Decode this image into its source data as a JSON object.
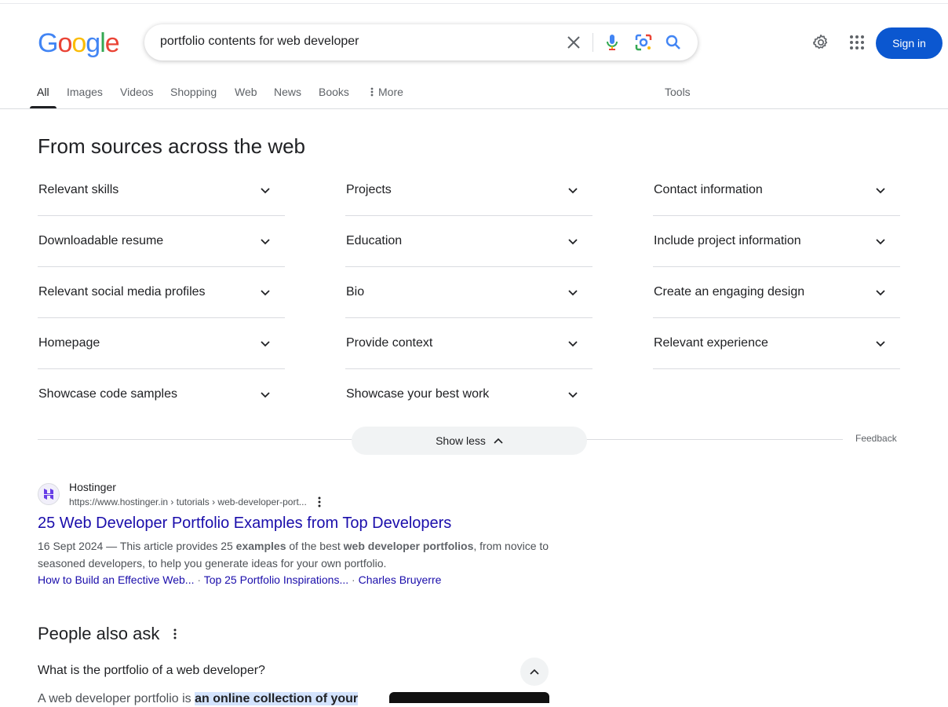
{
  "search": {
    "query": "portfolio contents for web developer"
  },
  "header": {
    "signin_label": "Sign in",
    "logo": [
      "G",
      "o",
      "o",
      "g",
      "l",
      "e"
    ],
    "logo_colors": [
      "#4285F4",
      "#EA4335",
      "#FBBC05",
      "#4285F4",
      "#34A853",
      "#EA4335"
    ]
  },
  "tabs": [
    {
      "label": "All",
      "active": true
    },
    {
      "label": "Images"
    },
    {
      "label": "Videos"
    },
    {
      "label": "Shopping"
    },
    {
      "label": "Web"
    },
    {
      "label": "News"
    },
    {
      "label": "Books"
    },
    {
      "label": "More"
    }
  ],
  "tools_label": "Tools",
  "sources": {
    "title": "From sources across the web",
    "columns": [
      [
        "Relevant skills",
        "Downloadable resume",
        "Relevant social media profiles",
        "Homepage",
        "Showcase code samples"
      ],
      [
        "Projects",
        "Education",
        "Bio",
        "Provide context",
        "Showcase your best work"
      ],
      [
        "Contact information",
        "Include project information",
        "Create an engaging design",
        "Relevant experience"
      ]
    ],
    "show_less_label": "Show less",
    "feedback_label": "Feedback"
  },
  "result": {
    "site_name": "Hostinger",
    "url": "https://www.hostinger.in › tutorials › web-developer-port...",
    "title": "25 Web Developer Portfolio Examples from Top Developers",
    "date": "16 Sept 2024",
    "snippet_pre": " — This article provides 25 ",
    "snippet_b1": "examples",
    "snippet_mid": " of the best ",
    "snippet_b2": "web developer portfolios",
    "snippet_post": ", from novice to seasoned developers, to help you generate ideas for your own portfolio.",
    "sitelinks": [
      "How to Build an Effective Web...",
      "Top 25 Portfolio Inspirations...",
      "Charles Bruyerre"
    ]
  },
  "paa": {
    "title": "People also ask",
    "question": "What is the portfolio of a web developer?",
    "answer_pre": "A web developer portfolio is ",
    "answer_highlight": "an online collection of your"
  },
  "colors": {
    "accent": "#0b57d0",
    "link": "#1a0dab"
  }
}
